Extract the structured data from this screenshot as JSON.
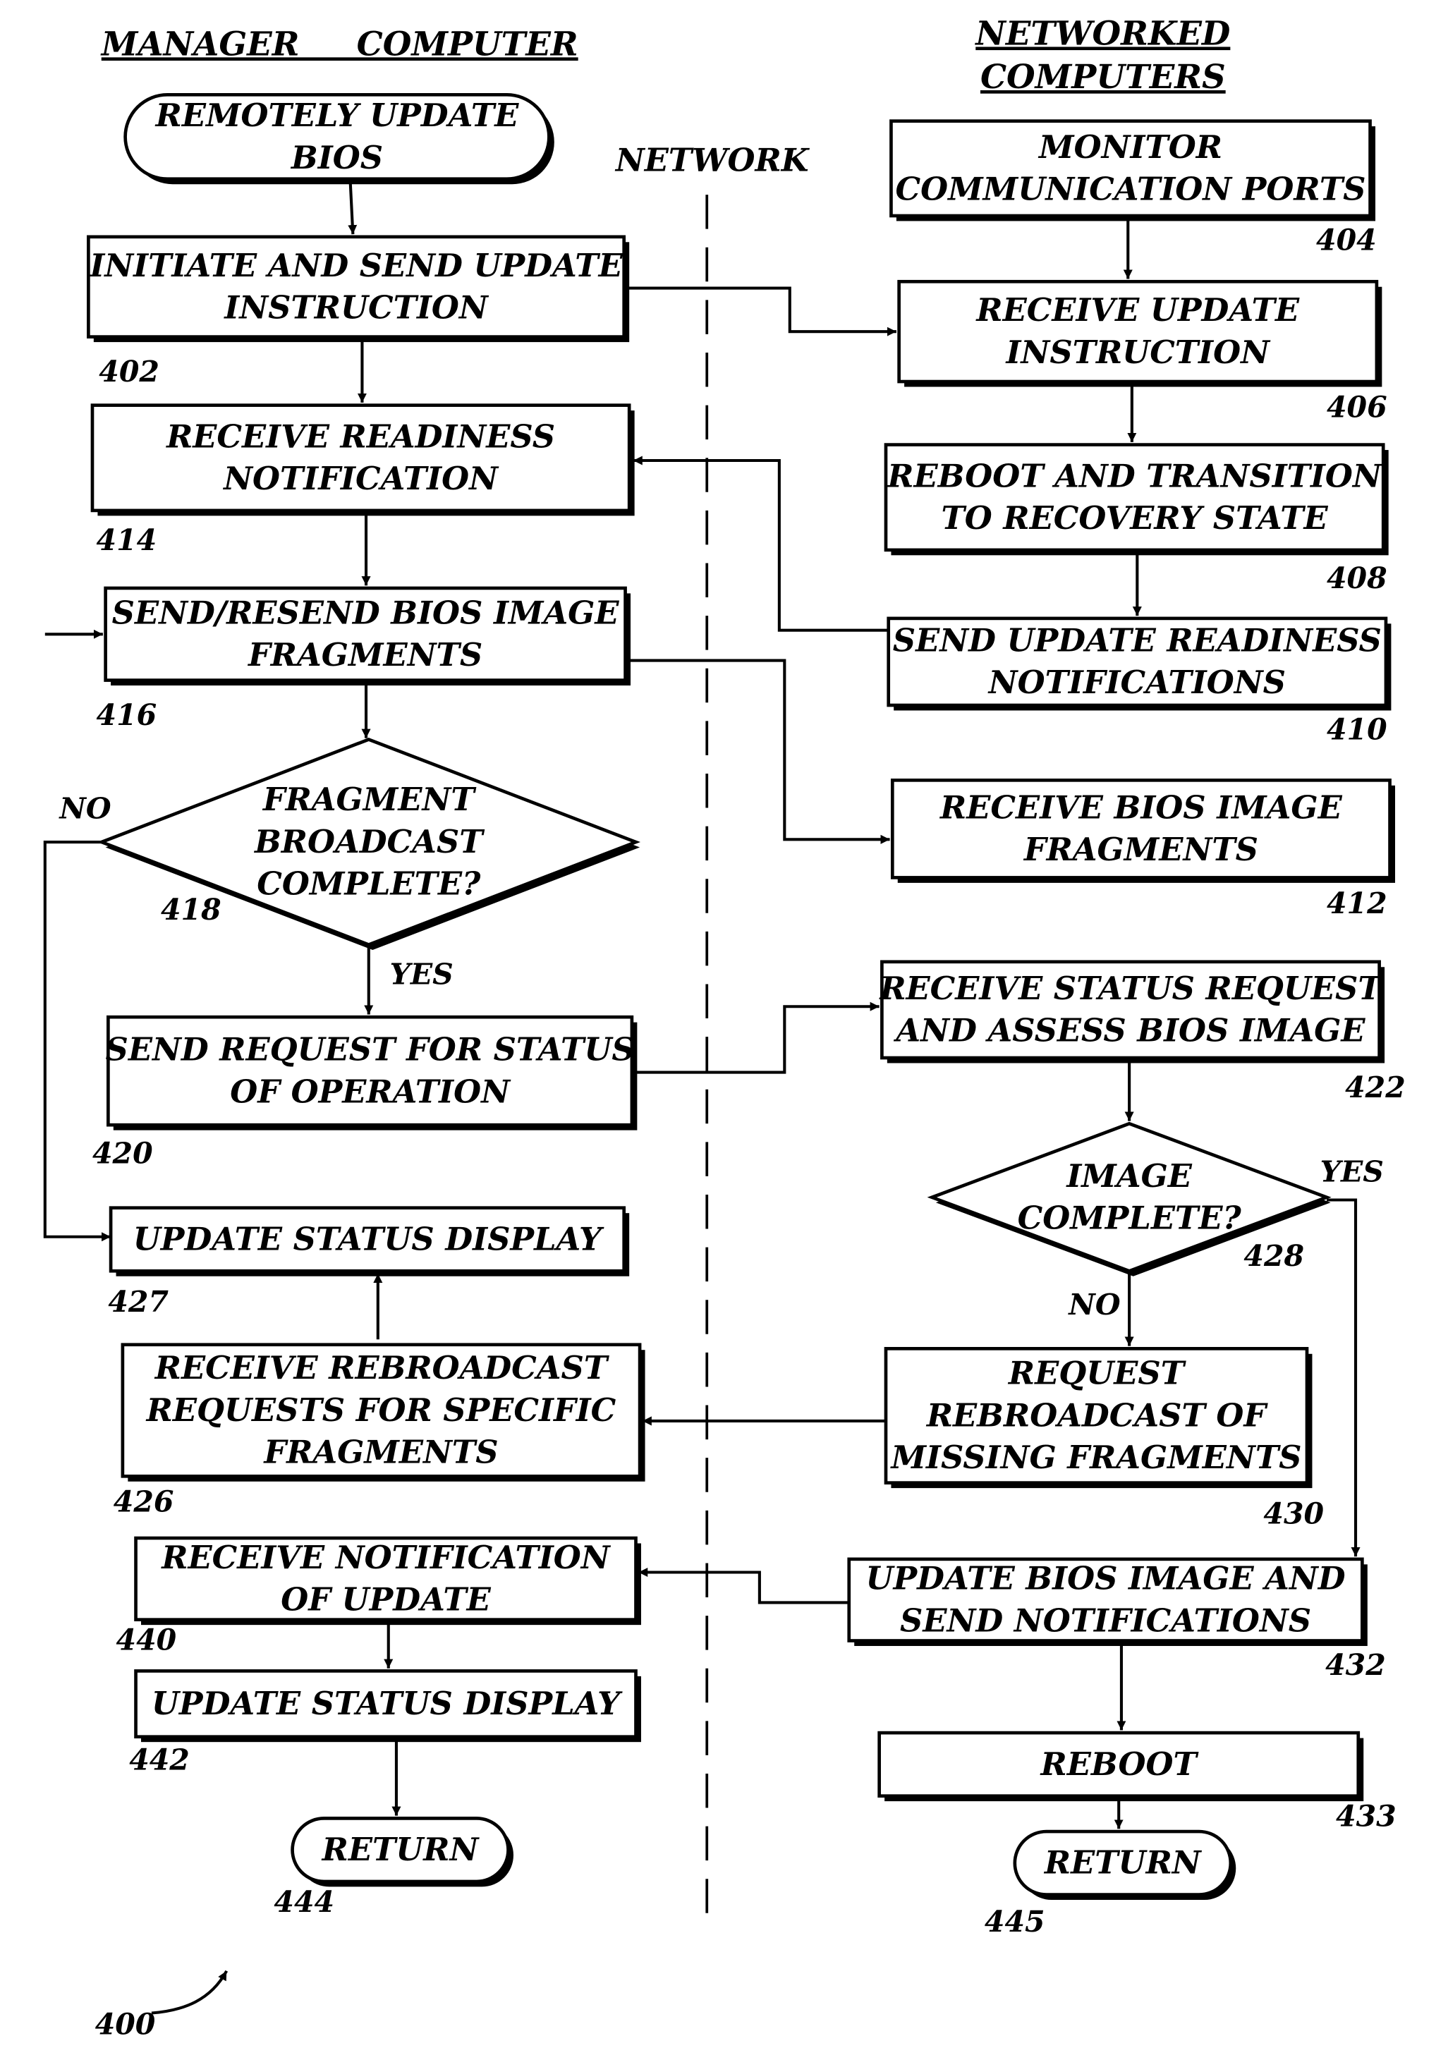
{
  "headers": {
    "manager": "MANAGER     COMPUTER",
    "networked_1": "NETWORKED",
    "networked_2": "COMPUTERS",
    "network": "NETWORK"
  },
  "nodes": {
    "start": {
      "lines": [
        "REMOTELY UPDATE",
        "BIOS"
      ]
    },
    "n402": {
      "lines": [
        "INITIATE AND SEND UPDATE",
        "INSTRUCTION"
      ],
      "ref": "402"
    },
    "n404": {
      "lines": [
        "MONITOR",
        "COMMUNICATION PORTS"
      ],
      "ref": "404"
    },
    "n406": {
      "lines": [
        "RECEIVE  UPDATE",
        "INSTRUCTION"
      ],
      "ref": "406"
    },
    "n408": {
      "lines": [
        "REBOOT AND TRANSITION",
        "TO RECOVERY STATE"
      ],
      "ref": "408"
    },
    "n410": {
      "lines": [
        "SEND UPDATE READINESS",
        "NOTIFICATIONS"
      ],
      "ref": "410"
    },
    "n412": {
      "lines": [
        "RECEIVE BIOS IMAGE",
        "FRAGMENTS"
      ],
      "ref": "412"
    },
    "n414": {
      "lines": [
        "RECEIVE READINESS",
        "NOTIFICATION"
      ],
      "ref": "414"
    },
    "n416": {
      "lines": [
        "SEND/RESEND BIOS IMAGE",
        "FRAGMENTS"
      ],
      "ref": "416"
    },
    "n418": {
      "lines": [
        "FRAGMENT",
        "BROADCAST",
        "COMPLETE?"
      ],
      "ref": "418",
      "no": "NO",
      "yes": "YES"
    },
    "n420": {
      "lines": [
        "SEND REQUEST FOR STATUS",
        "OF OPERATION"
      ],
      "ref": "420"
    },
    "n422": {
      "lines": [
        "RECEIVE STATUS REQUEST",
        "AND ASSESS BIOS IMAGE"
      ],
      "ref": "422"
    },
    "n426": {
      "lines": [
        "RECEIVE REBROADCAST",
        "REQUESTS FOR SPECIFIC",
        "FRAGMENTS"
      ],
      "ref": "426"
    },
    "n427": {
      "lines": [
        "UPDATE STATUS DISPLAY"
      ],
      "ref": "427"
    },
    "n428": {
      "lines": [
        "IMAGE",
        "COMPLETE?"
      ],
      "ref": "428",
      "no": "NO",
      "yes": "YES"
    },
    "n430": {
      "lines": [
        "REQUEST",
        "REBROADCAST OF",
        "MISSING FRAGMENTS"
      ],
      "ref": "430"
    },
    "n432": {
      "lines": [
        "UPDATE BIOS IMAGE AND",
        "SEND NOTIFICATIONS"
      ],
      "ref": "432"
    },
    "n433": {
      "lines": [
        "REBOOT"
      ],
      "ref": "433"
    },
    "n440": {
      "lines": [
        "RECEIVE NOTIFICATION",
        "OF UPDATE"
      ],
      "ref": "440"
    },
    "n442": {
      "lines": [
        "UPDATE STATUS DISPLAY"
      ],
      "ref": "442"
    },
    "n444": {
      "lines": [
        "RETURN"
      ],
      "ref": "444"
    },
    "n445": {
      "lines": [
        "RETURN"
      ],
      "ref": "445"
    }
  },
  "figure_ref": "400"
}
